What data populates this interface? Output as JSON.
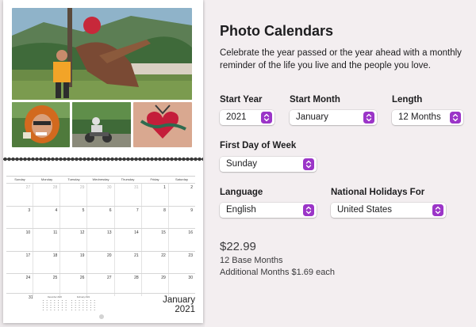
{
  "preview": {
    "weekdays": [
      "Sunday",
      "Monday",
      "Tuesday",
      "Wednesday",
      "Thursday",
      "Friday",
      "Saturday"
    ],
    "weeks": [
      [
        {
          "d": "27",
          "m": true
        },
        {
          "d": "28",
          "m": true
        },
        {
          "d": "29",
          "m": true
        },
        {
          "d": "30",
          "m": true
        },
        {
          "d": "31",
          "m": true
        },
        {
          "d": "1",
          "m": false
        },
        {
          "d": "2",
          "m": false
        }
      ],
      [
        {
          "d": "3",
          "m": false
        },
        {
          "d": "4",
          "m": false
        },
        {
          "d": "5",
          "m": false
        },
        {
          "d": "6",
          "m": false
        },
        {
          "d": "7",
          "m": false
        },
        {
          "d": "8",
          "m": false
        },
        {
          "d": "9",
          "m": false
        }
      ],
      [
        {
          "d": "10",
          "m": false
        },
        {
          "d": "11",
          "m": false
        },
        {
          "d": "12",
          "m": false
        },
        {
          "d": "13",
          "m": false
        },
        {
          "d": "14",
          "m": false
        },
        {
          "d": "15",
          "m": false
        },
        {
          "d": "16",
          "m": false
        }
      ],
      [
        {
          "d": "17",
          "m": false
        },
        {
          "d": "18",
          "m": false
        },
        {
          "d": "19",
          "m": false
        },
        {
          "d": "20",
          "m": false
        },
        {
          "d": "21",
          "m": false
        },
        {
          "d": "22",
          "m": false
        },
        {
          "d": "23",
          "m": false
        }
      ],
      [
        {
          "d": "24",
          "m": false
        },
        {
          "d": "25",
          "m": false
        },
        {
          "d": "26",
          "m": false
        },
        {
          "d": "27",
          "m": false
        },
        {
          "d": "28",
          "m": false
        },
        {
          "d": "29",
          "m": false
        },
        {
          "d": "30",
          "m": false
        }
      ]
    ],
    "last_day": "31",
    "mini_prev_title": "December 2020",
    "mini_next_title": "February 2021",
    "month": "January",
    "year": "2021"
  },
  "panel": {
    "title": "Photo Calendars",
    "description": "Celebrate the year passed or the year ahead with a monthly reminder of the life you live and the people you love.",
    "start_year": {
      "label": "Start Year",
      "value": "2021"
    },
    "start_month": {
      "label": "Start Month",
      "value": "January"
    },
    "length": {
      "label": "Length",
      "value": "12 Months"
    },
    "first_day": {
      "label": "First Day of Week",
      "value": "Sunday"
    },
    "language": {
      "label": "Language",
      "value": "English"
    },
    "holidays": {
      "label": "National Holidays For",
      "value": "United States"
    },
    "price": "$22.99",
    "base": "12 Base Months",
    "additional": "Additional Months $1.69 each"
  },
  "colors": {
    "accent": "#9b35c8",
    "background": "#f3eef0"
  },
  "icons": {
    "select_chevron": "chevron-up-down-icon"
  }
}
